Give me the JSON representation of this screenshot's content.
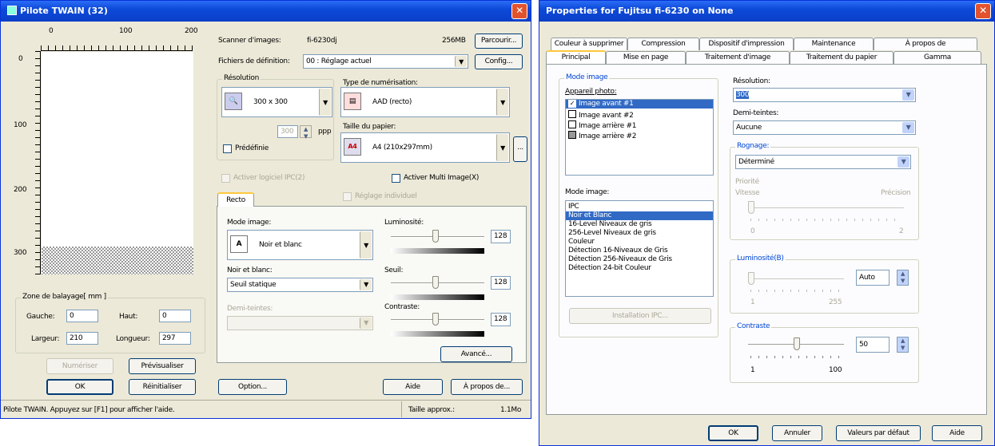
{
  "left": {
    "title": "Pilote TWAIN (32)",
    "ruler_h": [
      "0",
      "100",
      "200"
    ],
    "ruler_v": [
      "0",
      "100",
      "200",
      "300"
    ],
    "scanner_label": "Scanner d'images:",
    "scanner_value": "fi-6230dj",
    "memory": "256MB",
    "browse_btn": "Parcourir...",
    "def_label": "Fichiers de définition:",
    "def_value": "00 : Réglage actuel",
    "config_btn": "Config...",
    "res_group": "Résolution",
    "res_value": "300 x 300",
    "res_custom": "300",
    "res_unit": "ppp",
    "predefined": "Prédéfinie",
    "scan_type_group": "Type de numérisation:",
    "scan_type_value": "AAD (recto)",
    "paper_group": "Taille du papier:",
    "paper_value": "A4 (210x297mm)",
    "paper_more": "...",
    "ipc_check": "Activer logiciel IPC(2)",
    "multi_check": "Activer Multi Image(X)",
    "tab_recto": "Recto",
    "individual_check": "Réglage individuel",
    "mode_label": "Mode image:",
    "mode_value": "Noir et blanc",
    "bw_label": "Noir et blanc:",
    "bw_value": "Seuil statique",
    "halftone_label": "Demi-teintes:",
    "brightness_label": "Luminosité:",
    "brightness_value": "128",
    "threshold_label": "Seuil:",
    "threshold_value": "128",
    "contrast_label": "Contraste:",
    "contrast_value": "128",
    "advanced_btn": "Avancé...",
    "zone_group": "Zone de balayage[ mm ]",
    "left_label": "Gauche:",
    "left_value": "0",
    "top_label": "Haut:",
    "top_value": "0",
    "width_label": "Largeur:",
    "width_value": "210",
    "length_label": "Longueur:",
    "length_value": "297",
    "scan_btn": "Numériser",
    "preview_btn": "Prévisualiser",
    "ok_btn": "OK",
    "reset_btn": "Réinitialiser",
    "option_btn": "Option...",
    "help_btn": "Aide",
    "about_btn": "À propos de...",
    "status_text": "Pilote TWAIN. Appuyez sur [F1] pour afficher l'aide.",
    "size_label": "Taille approx.:",
    "size_value": "1.1Mo"
  },
  "right": {
    "title": "Properties for Fujitsu fi-6230 on None",
    "tabs_row1": [
      "Couleur à supprimer",
      "Compression",
      "Dispositif d'impression",
      "Maintenance",
      "À propos de"
    ],
    "tabs_row2": [
      "Principal",
      "Mise en page",
      "Traitement d'image",
      "Traitement du papier",
      "Gamma"
    ],
    "image_mode_group": "Mode image",
    "camera_label": "Appareil photo:",
    "camera_items": [
      "Image avant #1",
      "Image avant #2",
      "Image arrière #1",
      "Image arrière #2"
    ],
    "mode_list_label": "Mode image:",
    "mode_items": [
      "IPC",
      "Noir et Blanc",
      "16-Level Niveaux de gris",
      "256-Level Niveaux de gris",
      "Couleur",
      "Détection 16-Niveaux de Gris",
      "Détection 256-Niveaux de Gris",
      "Détection 24-bit Couleur"
    ],
    "ipc_btn": "Installation IPC...",
    "resolution_label": "Résolution:",
    "resolution_value": "300",
    "halftone_label": "Demi-teintes:",
    "halftone_value": "Aucune",
    "crop_group": "Rognage:",
    "crop_value": "Déterminé",
    "priority_label": "Priorité",
    "speed_label": "Vitesse",
    "precision_label": "Précision",
    "crop_min": "0",
    "crop_max": "2",
    "brightness_group": "Luminosité(B)",
    "brightness_value": "Auto",
    "brightness_min": "1",
    "brightness_max": "255",
    "contrast_group": "Contraste",
    "contrast_value": "50",
    "contrast_min": "1",
    "contrast_max": "100",
    "ok_btn": "OK",
    "cancel_btn": "Annuler",
    "defaults_btn": "Valeurs par défaut",
    "help_btn": "Aide"
  }
}
